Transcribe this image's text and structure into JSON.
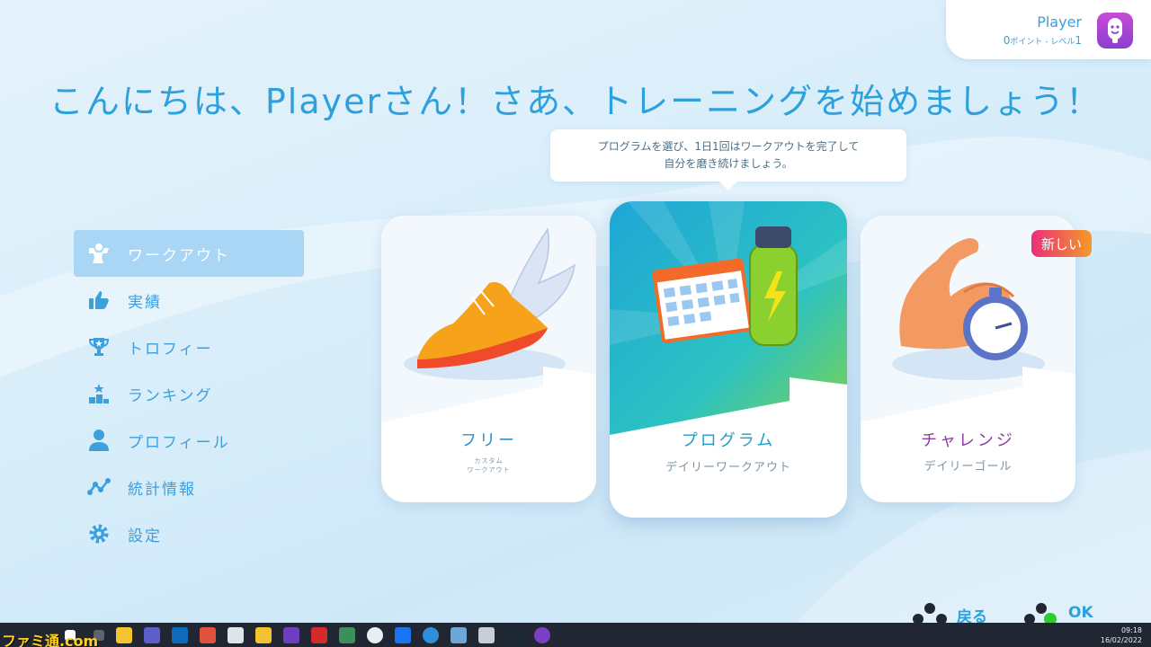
{
  "profile": {
    "name": "Player",
    "points_value": "0",
    "points_unit": "ポイント",
    "separator": "-",
    "level_label": "レベル",
    "level_value": "1"
  },
  "greeting": "こんにちは、Playerさん！さあ、トレーニングを始めましょう！",
  "tooltip": {
    "line1": "プログラムを選び、1日1回はワークアウトを完了して",
    "line2": "自分を磨き続けましょう。"
  },
  "sidebar": {
    "items": [
      {
        "label": "ワークアウト",
        "icon": "muscle-icon",
        "active": true
      },
      {
        "label": "実績",
        "icon": "thumbs-up-icon"
      },
      {
        "label": "トロフィー",
        "icon": "trophy-icon"
      },
      {
        "label": "ランキング",
        "icon": "podium-icon"
      },
      {
        "label": "プロフィール",
        "icon": "person-icon"
      },
      {
        "label": "統計情報",
        "icon": "stats-icon"
      },
      {
        "label": "設定",
        "icon": "gear-icon"
      }
    ]
  },
  "cards": [
    {
      "title": "フリー",
      "sub1": "カスタム",
      "sub2": "ワークアウト",
      "icon": "winged-shoe-icon",
      "color": "#2e8fd0"
    },
    {
      "title": "プログラム",
      "sub": "デイリーワークアウト",
      "icon": "calendar-bottle-icon",
      "color": "#1b9fc8"
    },
    {
      "title": "チャレンジ",
      "sub": "デイリーゴール",
      "icon": "arm-stopwatch-icon",
      "color": "#8e3aa8",
      "badge": "新しい"
    }
  ],
  "hints": {
    "back": "戻る",
    "ok": "OK"
  },
  "taskbar": {
    "time": "09:18",
    "date": "16/02/2022"
  },
  "watermark": "ファミ通.com"
}
